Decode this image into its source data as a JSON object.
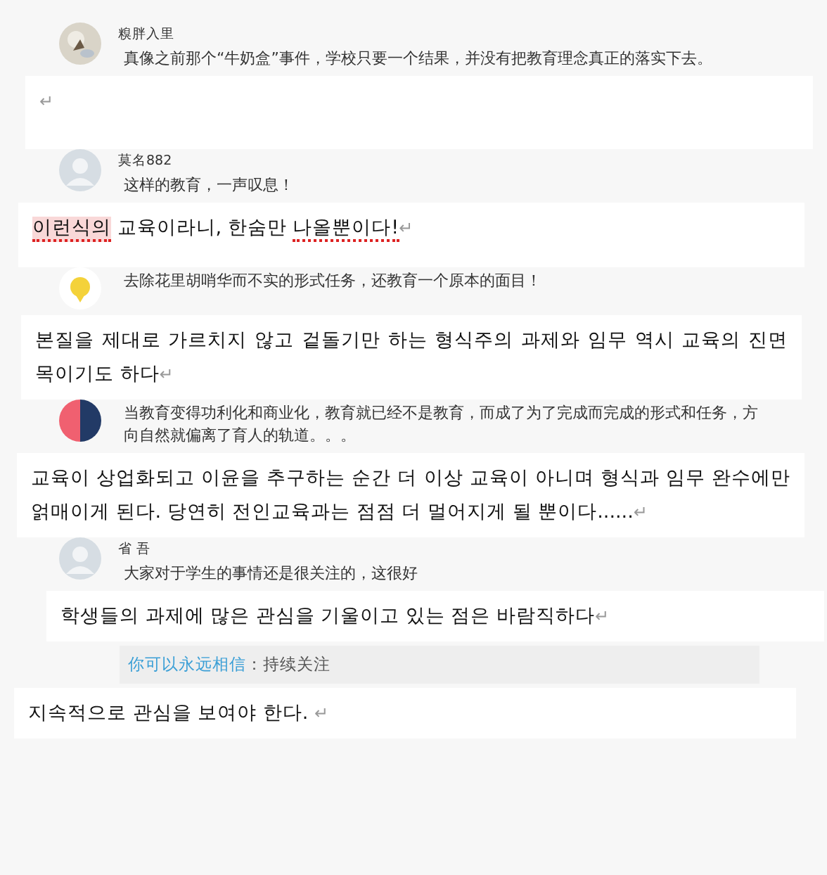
{
  "comments": [
    {
      "avatar": {
        "kind": "photo"
      },
      "name": "糗胖入里",
      "lines": [
        "真像之前那个“牛奶盒”事件，学校只要一个结果，并没有把教育理念真正的落实下去。"
      ],
      "translation": {
        "mark": "↵"
      }
    },
    {
      "avatar": {
        "kind": "default"
      },
      "name": "莫名882",
      "lines": [
        "这样的教育，一声叹息！"
      ],
      "translation": {
        "segments": [
          {
            "text": "이런식의",
            "highlight": true,
            "misspelled": true
          },
          {
            "text": " 교육이라니, 한숨만 ",
            "highlight": false,
            "misspelled": false
          },
          {
            "text": "나올뿐이다!",
            "highlight": false,
            "misspelled": true
          }
        ],
        "mark": "↵"
      }
    },
    {
      "avatar": {
        "kind": "emoji"
      },
      "lines": [
        "去除花里胡哨华而不实的形式任务，还教育一个原本的面目！"
      ],
      "translation": {
        "segments": [
          {
            "text": "본질을 제대로 가르치지 않고 겉돌기만 하는 형식주의 과제와 임무 역시 교육의 진면목이기도 하다",
            "highlight": false,
            "misspelled": false
          }
        ],
        "mark": "↵"
      }
    },
    {
      "avatar": {
        "kind": "split"
      },
      "lines": [
        "当教育变得功利化和商业化，教育就已经不是教育，而成了为了完成而完成的形式和任务，方向自然就偏离了育人的轨道。。。"
      ],
      "translation": {
        "segments": [
          {
            "text": "교육이 상업화되고 이윤을 추구하는 순간 더 이상 교육이 아니며 형식과 임무 완수에만 얽매이게 된다. 당연히 전인교육과는 점점 더 멀어지게 될 뿐이다......",
            "highlight": false,
            "misspelled": false
          }
        ],
        "mark": "↵"
      }
    },
    {
      "avatar": {
        "kind": "default"
      },
      "name": "省 吾",
      "lines": [
        "大家对于学生的事情还是很关注的，这很好"
      ],
      "translation": {
        "segments": [
          {
            "text": "학생들의 과제에 많은 관심을 기울이고 있는 점은 바람직하다",
            "highlight": false,
            "misspelled": false
          }
        ],
        "mark": "↵"
      },
      "reply": {
        "author": "你可以永远相信",
        "text": "：持续关注"
      },
      "translation2": {
        "segments": [
          {
            "text": "지속적으로 관심을 보여야 한다. ",
            "highlight": false,
            "misspelled": false
          }
        ],
        "mark": "↵"
      }
    }
  ]
}
